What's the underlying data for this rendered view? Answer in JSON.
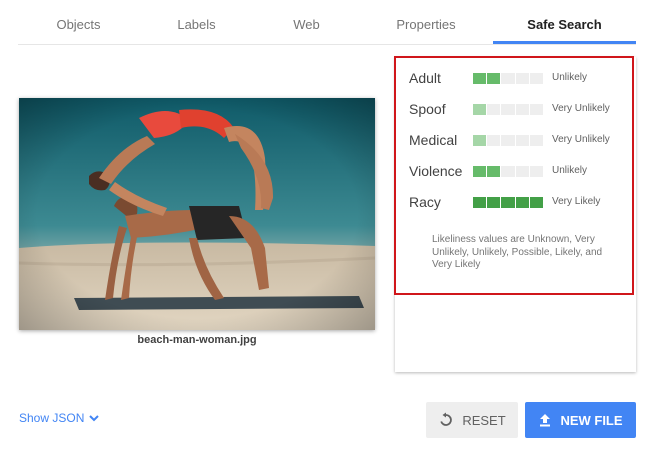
{
  "tabs": [
    {
      "label": "Objects"
    },
    {
      "label": "Labels"
    },
    {
      "label": "Web"
    },
    {
      "label": "Properties"
    },
    {
      "label": "Safe Search",
      "active": true
    }
  ],
  "image": {
    "filename": "beach-man-woman.jpg"
  },
  "safe_search": {
    "rows": [
      {
        "label": "Adult",
        "value": "Unlikely",
        "level": 2
      },
      {
        "label": "Spoof",
        "value": "Very Unlikely",
        "level": 1
      },
      {
        "label": "Medical",
        "value": "Very Unlikely",
        "level": 1
      },
      {
        "label": "Violence",
        "value": "Unlikely",
        "level": 2
      },
      {
        "label": "Racy",
        "value": "Very Likely",
        "level": 5
      }
    ],
    "max_level": 5,
    "note": "Likeliness values are Unknown, Very Unlikely, Unlikely, Possible, Likely, and Very Likely"
  },
  "footer": {
    "show_json_label": "Show JSON",
    "reset_label": "RESET",
    "new_file_label": "NEW FILE"
  },
  "colors": {
    "accent": "#4285f4",
    "highlight": "#d0161b",
    "meter_on": "#66bb6a"
  }
}
